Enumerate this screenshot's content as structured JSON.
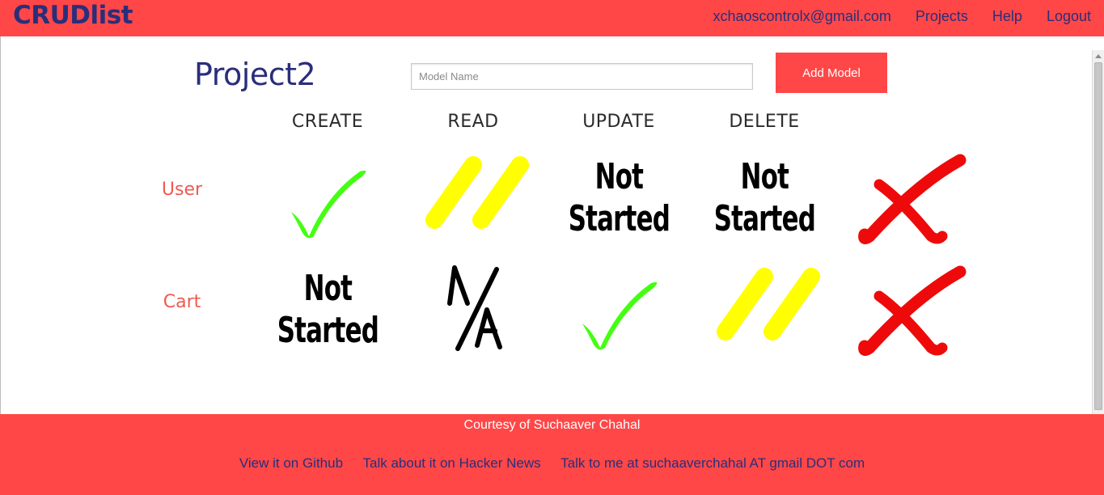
{
  "header": {
    "brand": "CRUDlist",
    "nav": [
      "xchaoscontrolx@gmail.com",
      "Projects",
      "Help",
      "Logout"
    ]
  },
  "project": {
    "title": "Project2",
    "model_input": {
      "value": "",
      "placeholder": "Model Name"
    },
    "add_button": "Add Model"
  },
  "table": {
    "columns": [
      "CREATE",
      "READ",
      "UPDATE",
      "DELETE"
    ],
    "rows": [
      {
        "label": "User",
        "cells": [
          {
            "status": "done",
            "icon": "green-check-icon"
          },
          {
            "status": "in-progress",
            "icon": "yellow-pause-icon"
          },
          {
            "status": "not-started",
            "text_line1": "Not",
            "text_line2": "Started"
          },
          {
            "status": "not-started",
            "text_line1": "Not",
            "text_line2": "Started"
          }
        ],
        "delete_icon": "red-x-icon"
      },
      {
        "label": "Cart",
        "cells": [
          {
            "status": "not-started",
            "text_line1": "Not",
            "text_line2": "Started"
          },
          {
            "status": "n/a",
            "icon": "na-icon"
          },
          {
            "status": "done",
            "icon": "green-check-icon"
          },
          {
            "status": "in-progress",
            "icon": "yellow-pause-icon"
          }
        ],
        "delete_icon": "red-x-icon"
      }
    ]
  },
  "footer": {
    "courtesy": "Courtesy of Suchaaver Chahal",
    "links": [
      "View it on Github",
      "Talk about it on Hacker News",
      "Talk to me at suchaaverchahal AT gmail DOT com"
    ]
  },
  "colors": {
    "accent_red": "#ff4747",
    "brand_navy": "#2a2e7a",
    "row_label_red": "#f05a4f",
    "done_green": "#44ff11",
    "progress_yellow": "#ffff00",
    "delete_red": "#ee0a0a"
  }
}
